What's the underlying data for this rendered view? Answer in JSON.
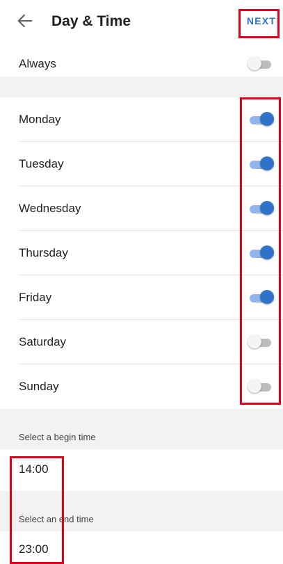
{
  "header": {
    "title": "Day & Time",
    "next_label": "NEXT",
    "back_icon": "arrow-left-icon"
  },
  "always": {
    "label": "Always",
    "on": false
  },
  "days": [
    {
      "label": "Monday",
      "on": true
    },
    {
      "label": "Tuesday",
      "on": true
    },
    {
      "label": "Wednesday",
      "on": true
    },
    {
      "label": "Thursday",
      "on": true
    },
    {
      "label": "Friday",
      "on": true
    },
    {
      "label": "Saturday",
      "on": false
    },
    {
      "label": "Sunday",
      "on": false
    }
  ],
  "begin": {
    "caption": "Select a begin time",
    "value": "14:00"
  },
  "end": {
    "caption": "Select an end time",
    "value": "23:00"
  },
  "colors": {
    "accent": "#2f72c9",
    "toggle_on_track": "#8eb6ea",
    "highlight": "#e0001b"
  }
}
